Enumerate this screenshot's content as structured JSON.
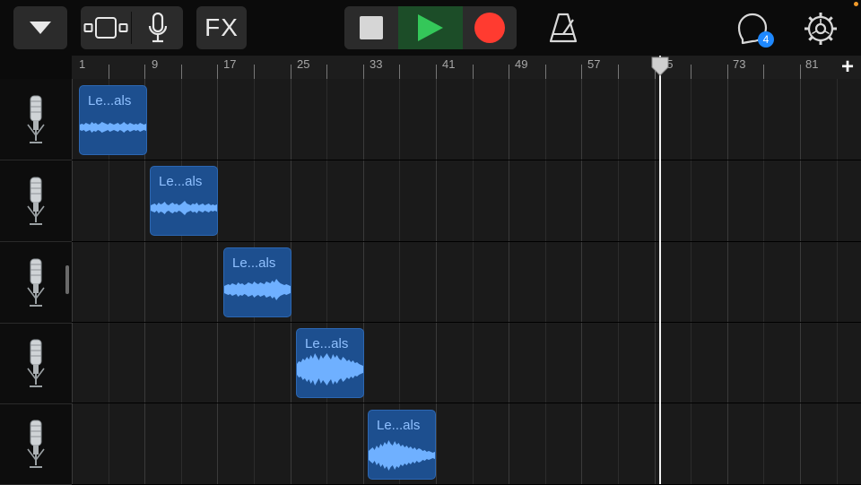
{
  "toolbar": {
    "fx_label": "FX",
    "badge_count": "4",
    "colors": {
      "play_bg": "#1c4d28",
      "play_icon": "#34c759",
      "record": "#ff3b30",
      "badge": "#1e88ff"
    },
    "icons": [
      "browser-dropdown-icon",
      "tracks-view-icon",
      "microphone-icon",
      "stop-icon",
      "play-icon",
      "record-icon",
      "metronome-icon",
      "loop-browser-icon",
      "settings-gear-icon"
    ]
  },
  "ruler": {
    "bars": [
      "1",
      "9",
      "17",
      "25",
      "33",
      "41",
      "49",
      "57",
      "65",
      "73",
      "81"
    ],
    "add_section": "+"
  },
  "tracks": [
    {
      "instrument_icon": "condenser-mic-icon",
      "region": {
        "name": "Le...als"
      }
    },
    {
      "instrument_icon": "condenser-mic-icon",
      "region": {
        "name": "Le...als"
      }
    },
    {
      "instrument_icon": "condenser-mic-icon",
      "region": {
        "name": "Le...als"
      }
    },
    {
      "instrument_icon": "condenser-mic-icon",
      "region": {
        "name": "Le...als"
      }
    },
    {
      "instrument_icon": "condenser-mic-icon",
      "region": {
        "name": "Le...als"
      }
    }
  ],
  "playhead_bar": 65
}
